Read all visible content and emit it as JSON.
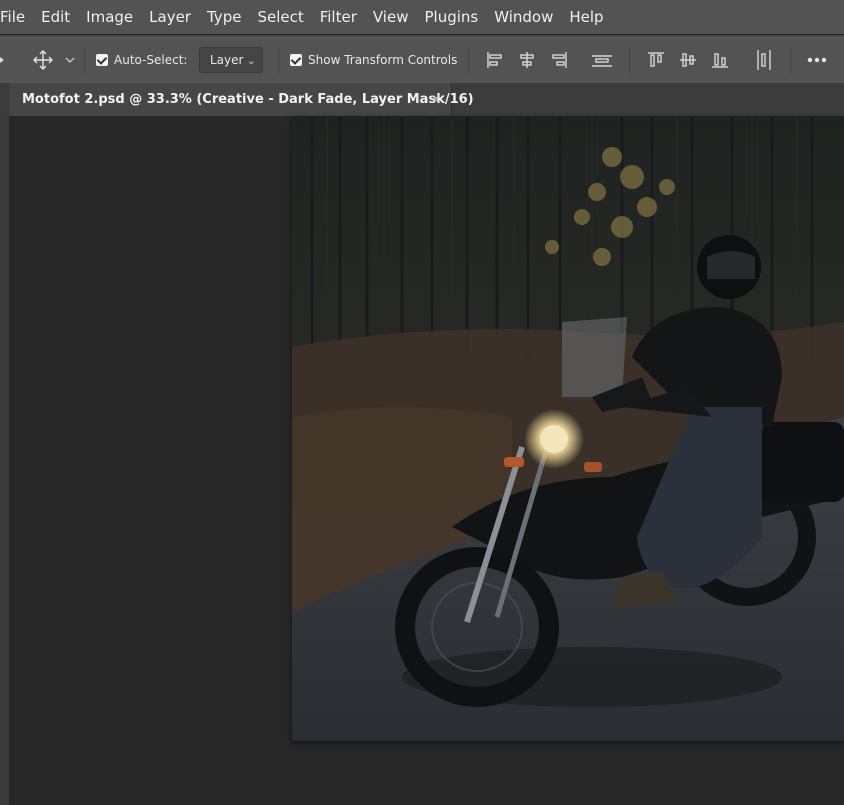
{
  "menubar": {
    "items": [
      "File",
      "Edit",
      "Image",
      "Layer",
      "Type",
      "Select",
      "Filter",
      "View",
      "Plugins",
      "Window",
      "Help"
    ]
  },
  "options": {
    "tool_icon": "move-icon",
    "auto_select_label": "Auto-Select:",
    "auto_select_checked": true,
    "layer_select_value": "Layer",
    "show_transform_label": "Show Transform Controls",
    "show_transform_checked": true,
    "align_icons": [
      "align-left-edges-icon",
      "align-horizontal-centers-icon",
      "align-right-edges-icon",
      "distribute-vertically-icon",
      "align-top-edges-icon",
      "align-vertical-centers-icon",
      "align-bottom-edges-icon",
      "distribute-horizontally-icon"
    ],
    "more_icon": "more-icon"
  },
  "document": {
    "tab_title": "Motofot 2.psd @ 33.3% (Creative - Dark Fade, Layer Mask/16)",
    "close_glyph": "×"
  },
  "colors": {
    "menubar_bg": "#535353",
    "workspace_bg": "#282828",
    "tab_active_bg": "#464646"
  }
}
